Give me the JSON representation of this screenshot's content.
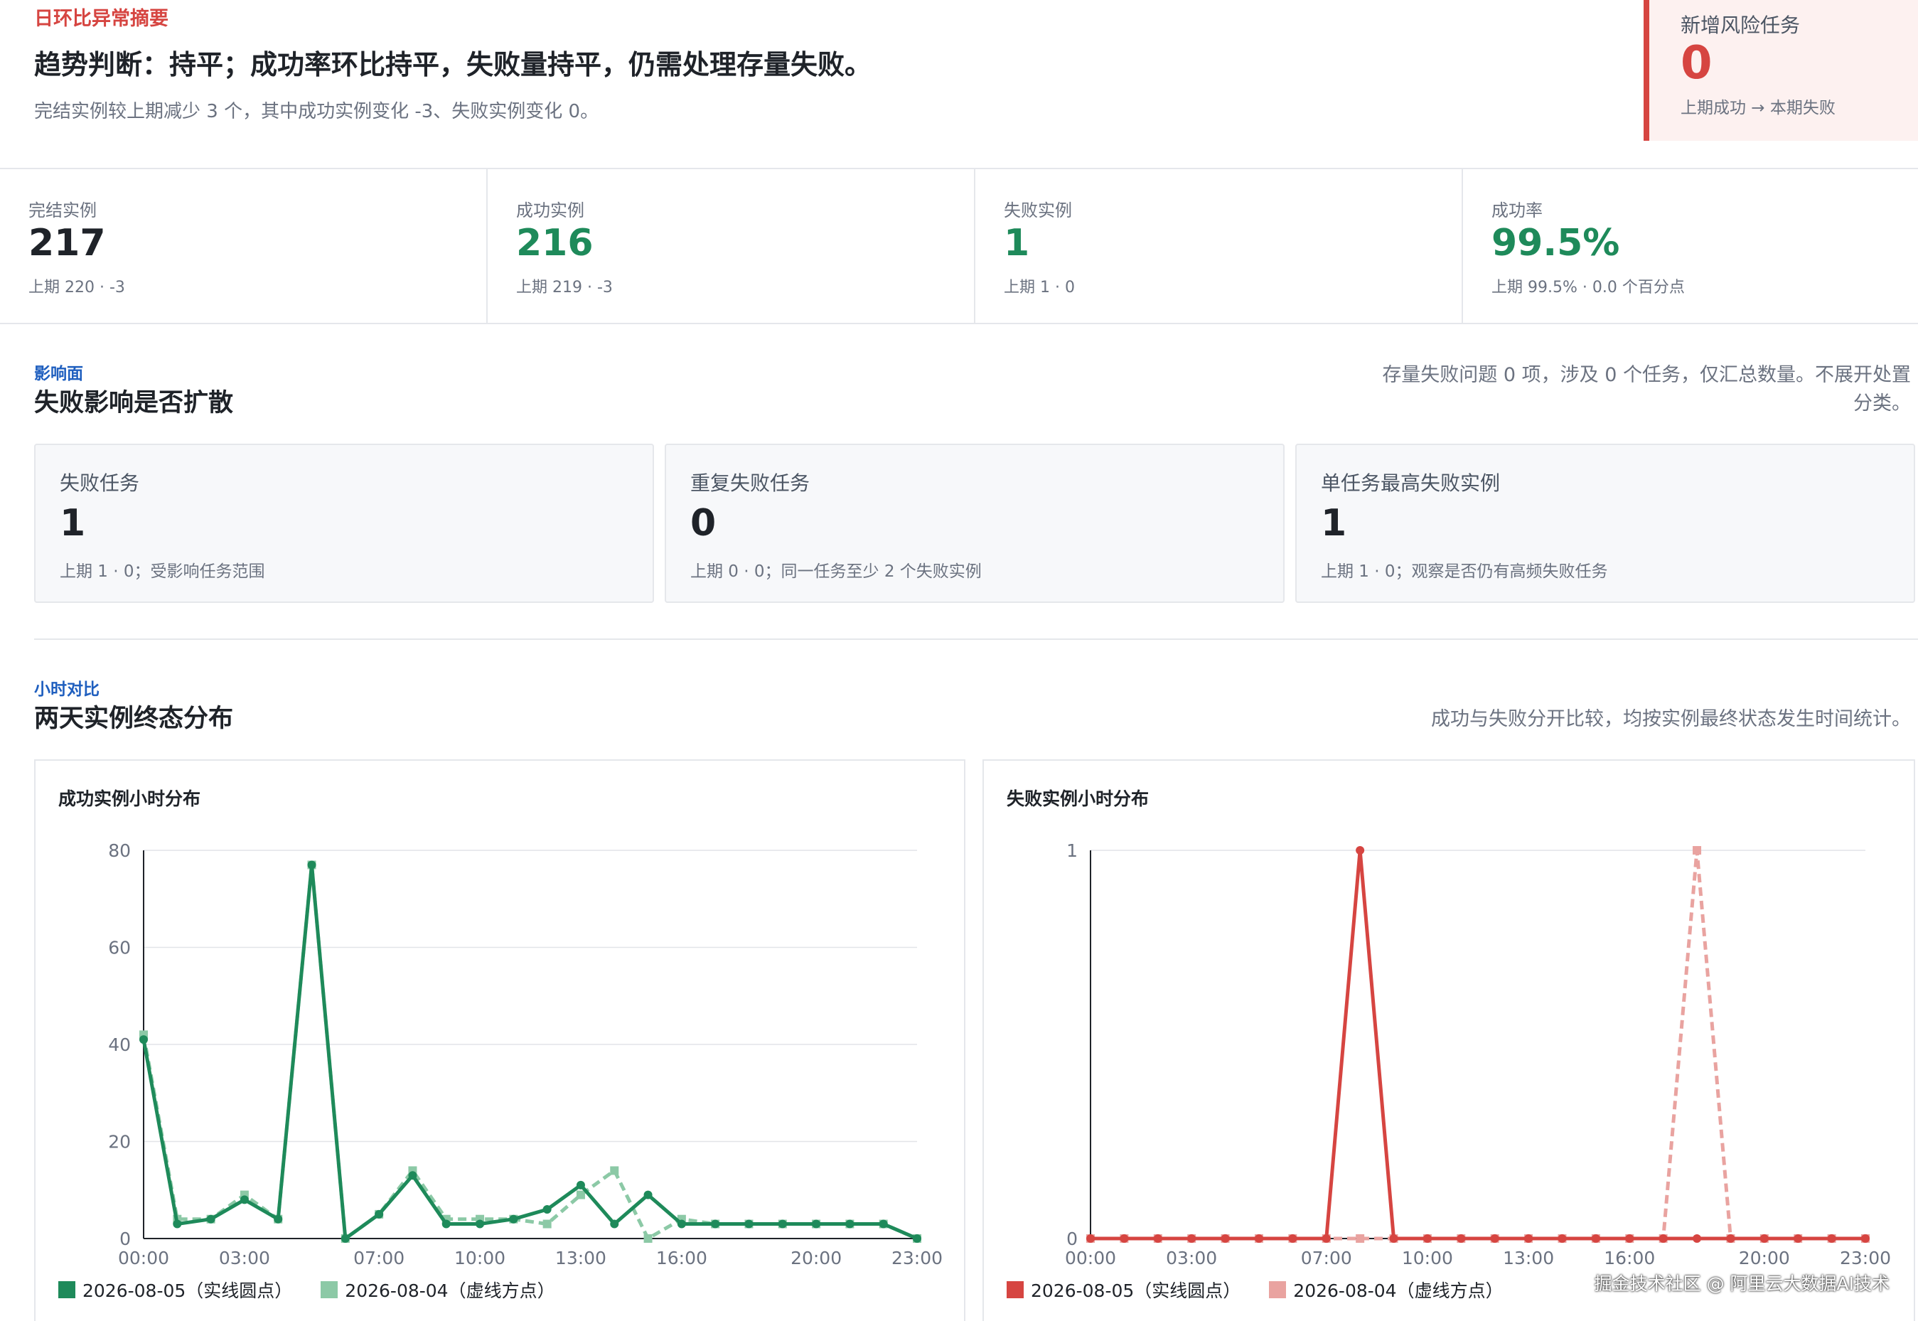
{
  "summary": {
    "eyebrow": "日环比异常摘要",
    "headline": "趋势判断：持平；成功率环比持平，失败量持平，仍需处理存量失败。",
    "subline": "完结实例较上期减少 3 个，其中成功实例变化 -3、失败实例变化 0。",
    "risk": {
      "title": "新增风险任务",
      "value": "0",
      "desc": "上期成功 → 本期失败"
    }
  },
  "kpis": [
    {
      "label": "完结实例",
      "value": "217",
      "sub": "上期 220 · -3",
      "color": "#1f2329"
    },
    {
      "label": "成功实例",
      "value": "216",
      "sub": "上期 219 · -3",
      "color": "#1e8a5a"
    },
    {
      "label": "失败实例",
      "value": "1",
      "sub": "上期 1 · 0",
      "color": "#1e8a5a"
    },
    {
      "label": "成功率",
      "value": "99.5%",
      "sub": "上期 99.5% · 0.0 个百分点",
      "color": "#1e8a5a"
    }
  ],
  "impact": {
    "eyebrow": "影响面",
    "title": "失败影响是否扩散",
    "note_line1": "存量失败问题 0 项，涉及 0 个任务，仅汇总数量。不展开处置",
    "note_line2": "分类。",
    "cards": [
      {
        "label": "失败任务",
        "value": "1",
        "sub": "上期 1 · 0；受影响任务范围"
      },
      {
        "label": "重复失败任务",
        "value": "0",
        "sub": "上期 0 · 0；同一任务至少 2 个失败实例"
      },
      {
        "label": "单任务最高失败实例",
        "value": "1",
        "sub": "上期 1 · 0；观察是否仍有高频失败任务"
      }
    ]
  },
  "hourly": {
    "eyebrow": "小时对比",
    "title": "两天实例终态分布",
    "note": "成功与失败分开比较，均按实例最终状态发生时间统计。"
  },
  "chart_data": [
    {
      "type": "line",
      "title": "成功实例小时分布",
      "x": [
        "00:00",
        "01:00",
        "02:00",
        "03:00",
        "04:00",
        "05:00",
        "06:00",
        "07:00",
        "08:00",
        "09:00",
        "10:00",
        "11:00",
        "12:00",
        "13:00",
        "14:00",
        "15:00",
        "16:00",
        "17:00",
        "18:00",
        "19:00",
        "20:00",
        "21:00",
        "22:00",
        "23:00"
      ],
      "x_tick_labels": [
        "00:00",
        "03:00",
        "07:00",
        "10:00",
        "13:00",
        "16:00",
        "20:00",
        "23:00"
      ],
      "ylim": [
        0,
        80
      ],
      "y_ticks": [
        0,
        20,
        40,
        60,
        80
      ],
      "grid": true,
      "legend": "bottom-left",
      "series": [
        {
          "name": "2026-08-05（实线圆点）",
          "color": "#1e8a5a",
          "style": "solid",
          "marker": "circle",
          "values": [
            41,
            3,
            4,
            8,
            4,
            77,
            0,
            5,
            13,
            3,
            3,
            4,
            6,
            11,
            3,
            9,
            3,
            3,
            3,
            3,
            3,
            3,
            3,
            0
          ]
        },
        {
          "name": "2026-08-04（虚线方点）",
          "color": "#8cc9a6",
          "style": "dashed",
          "marker": "square",
          "values": [
            42,
            4,
            4,
            9,
            4,
            77,
            0,
            5,
            14,
            4,
            4,
            4,
            3,
            9,
            14,
            0,
            4,
            3,
            3,
            3,
            3,
            3,
            3,
            0
          ]
        }
      ]
    },
    {
      "type": "line",
      "title": "失败实例小时分布",
      "x": [
        "00:00",
        "01:00",
        "02:00",
        "03:00",
        "04:00",
        "05:00",
        "06:00",
        "07:00",
        "08:00",
        "09:00",
        "10:00",
        "11:00",
        "12:00",
        "13:00",
        "14:00",
        "15:00",
        "16:00",
        "17:00",
        "18:00",
        "19:00",
        "20:00",
        "21:00",
        "22:00",
        "23:00"
      ],
      "x_tick_labels": [
        "00:00",
        "03:00",
        "07:00",
        "10:00",
        "13:00",
        "16:00",
        "20:00",
        "23:00"
      ],
      "ylim": [
        0,
        1
      ],
      "y_ticks": [
        0,
        1
      ],
      "grid": true,
      "legend": "bottom-left",
      "series": [
        {
          "name": "2026-08-05（实线圆点）",
          "color": "#d64541",
          "style": "solid",
          "marker": "circle",
          "values": [
            0,
            0,
            0,
            0,
            0,
            0,
            0,
            0,
            1,
            0,
            0,
            0,
            0,
            0,
            0,
            0,
            0,
            0,
            0,
            0,
            0,
            0,
            0,
            0
          ]
        },
        {
          "name": "2026-08-04（虚线方点）",
          "color": "#e9a3a0",
          "style": "dashed",
          "marker": "square",
          "values": [
            0,
            0,
            0,
            0,
            0,
            0,
            0,
            0,
            0,
            0,
            0,
            0,
            0,
            0,
            0,
            0,
            0,
            0,
            1,
            0,
            0,
            0,
            0,
            0
          ]
        }
      ]
    }
  ],
  "watermark": "掘金技术社区 @ 阿里云大数据AI技术"
}
